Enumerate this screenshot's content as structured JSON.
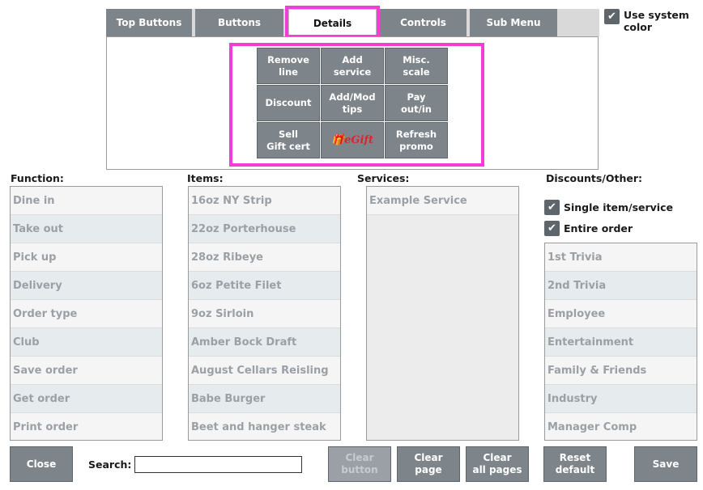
{
  "tabs": [
    {
      "label": "Top Buttons",
      "active": false
    },
    {
      "label": "Buttons",
      "active": false
    },
    {
      "label": "Details",
      "active": true
    },
    {
      "label": "Controls",
      "active": false
    },
    {
      "label": "Sub Menu",
      "active": false
    }
  ],
  "system_color": {
    "label": "Use system color",
    "checked": true
  },
  "grid_buttons": [
    {
      "label": "Remove\nline"
    },
    {
      "label": "Add\nservice"
    },
    {
      "label": "Misc.\nscale"
    },
    {
      "label": "Discount"
    },
    {
      "label": "Add/Mod\ntips"
    },
    {
      "label": "Pay\nout/in"
    },
    {
      "label": "Sell\nGift cert"
    },
    {
      "label": "eGift",
      "icon": "gift-logo-icon"
    },
    {
      "label": "Refresh\npromo"
    }
  ],
  "sections": {
    "function": "Function:",
    "items": "Items:",
    "services": "Services:",
    "discounts": "Discounts/Other:"
  },
  "function_list": [
    "Dine in",
    "Take out",
    "Pick up",
    "Delivery",
    "Order type",
    "Club",
    "Save order",
    "Get order",
    "Print order"
  ],
  "items_list": [
    "16oz NY Strip",
    "22oz Porterhouse",
    "28oz Ribeye",
    "6oz Petite Filet",
    "9oz Sirloin",
    "Amber Bock Draft",
    "August Cellars Reisling",
    "Babe Burger",
    "Beet and hanger steak"
  ],
  "services_list": [
    "Example Service"
  ],
  "discount_options": [
    {
      "label": "Single item/service",
      "checked": true
    },
    {
      "label": "Entire order",
      "checked": true
    }
  ],
  "discounts_list": [
    "1st Trivia",
    "2nd Trivia",
    "Employee",
    "Entertainment",
    "Family & Friends",
    "Industry",
    "Manager Comp"
  ],
  "bottom": {
    "close": "Close",
    "search_label": "Search:",
    "search_value": "",
    "clear_button": "Clear\nbutton",
    "clear_page": "Clear\npage",
    "clear_all_pages": "Clear\nall pages",
    "reset_default": "Reset\ndefault",
    "save": "Save"
  },
  "colors": {
    "button_bg": "#7d858b",
    "highlight": "#f03fd6",
    "row_text": "#9aa0a5"
  }
}
